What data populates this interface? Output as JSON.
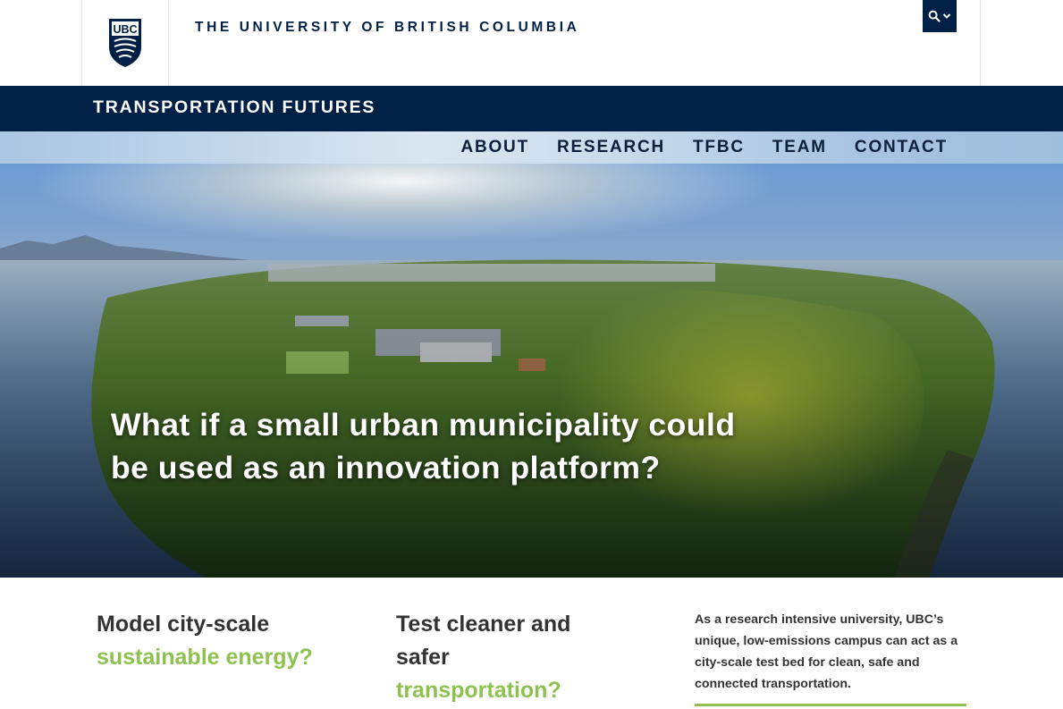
{
  "header": {
    "logo_text": "UBC",
    "university_name": "THE UNIVERSITY OF BRITISH COLUMBIA",
    "search_icon": "search-icon",
    "search_menu_icon": "chevron-down-icon"
  },
  "unit": {
    "name": "TRANSPORTATION FUTURES"
  },
  "nav": {
    "items": [
      {
        "label": "ABOUT"
      },
      {
        "label": "RESEARCH"
      },
      {
        "label": "TFBC"
      },
      {
        "label": "TEAM"
      },
      {
        "label": "CONTACT"
      }
    ]
  },
  "hero": {
    "title": "What if a small urban municipality could be used as an innovation platform?"
  },
  "features": [
    {
      "line1": "Model city-scale",
      "line2": "sustainable energy?"
    },
    {
      "line1": "Test cleaner and safer",
      "line2": "transportation?"
    }
  ],
  "intro": {
    "text": "As a research intensive university, UBC’s unique, low-emissions campus can act as a city-scale test bed for clean, safe and connected transportation."
  },
  "colors": {
    "ubc_navy": "#002145",
    "accent_green": "#8fc150",
    "nav_text": "#0c1f3b",
    "body_text": "#333333"
  }
}
